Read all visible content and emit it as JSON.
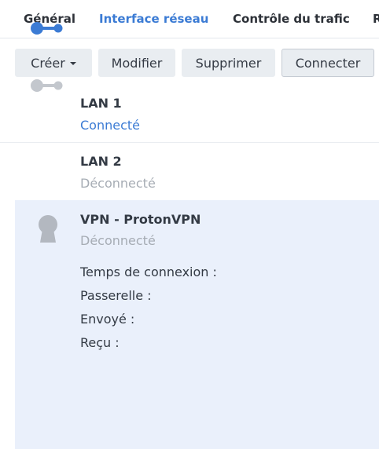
{
  "tabs": [
    {
      "label": "Général"
    },
    {
      "label": "Interface réseau"
    },
    {
      "label": "Contrôle du trafic"
    },
    {
      "label": "R"
    }
  ],
  "toolbar": {
    "create_label": "Créer",
    "edit_label": "Modifier",
    "delete_label": "Supprimer",
    "connect_label": "Connecter"
  },
  "interfaces": [
    {
      "name": "LAN 1",
      "status": "Connecté",
      "icon": "ethernet-connected-icon"
    },
    {
      "name": "LAN 2",
      "status": "Déconnecté",
      "icon": "ethernet-disconnected-icon"
    },
    {
      "name": "VPN - ProtonVPN",
      "status": "Déconnecté",
      "icon": "vpn-keyhole-icon",
      "details": [
        {
          "label": "Temps de connexion :"
        },
        {
          "label": "Passerelle :"
        },
        {
          "label": "Envoyé :"
        },
        {
          "label": "Reçu :"
        }
      ]
    }
  ],
  "colors": {
    "accent": "#3b7bd4",
    "selected_row": "#eaf0fb",
    "muted_text": "#a6acb4",
    "button_bg": "#e9edf1"
  }
}
